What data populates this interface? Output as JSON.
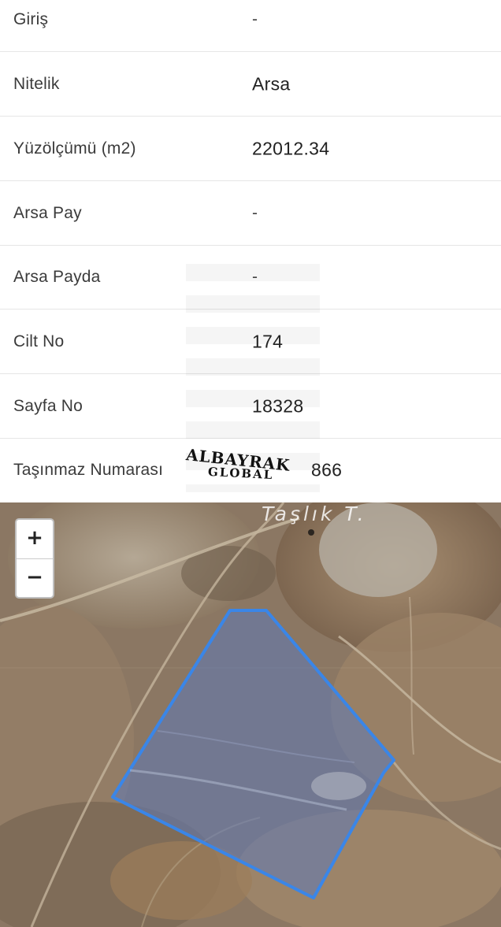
{
  "property_details": [
    {
      "label": "Giriş",
      "value": "-"
    },
    {
      "label": "Nitelik",
      "value": "Arsa"
    },
    {
      "label": "Yüzölçümü (m2)",
      "value": "22012.34"
    },
    {
      "label": "Arsa Pay",
      "value": "-"
    },
    {
      "label": "Arsa Payda",
      "value": "-"
    },
    {
      "label": "Cilt No",
      "value": "174"
    },
    {
      "label": "Sayfa No",
      "value": "18328"
    },
    {
      "label": "Taşınmaz Numarası",
      "value": "866"
    }
  ],
  "watermark": {
    "main": "ALBAYRAK",
    "sub": "GLOBAL"
  },
  "map": {
    "place_label": "Taşlık T.",
    "zoom_in_label": "+",
    "zoom_out_label": "−",
    "parcel_outline_color": "#3a86e8",
    "parcel_fill_color": "#5f7ab8"
  }
}
